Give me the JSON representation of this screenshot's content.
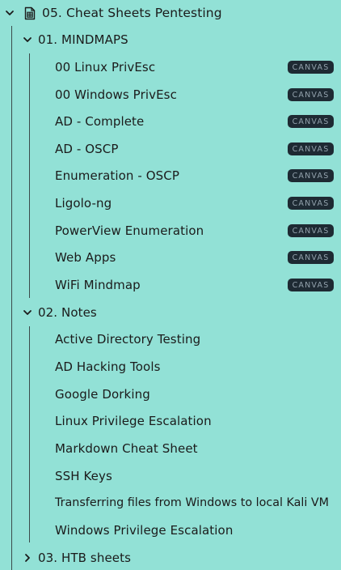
{
  "root": {
    "label": "05. Cheat Sheets Pentesting",
    "icon": "spreadsheet-file-icon",
    "expanded": true
  },
  "folders": [
    {
      "label": "01. MINDMAPS",
      "expanded": true,
      "items": [
        {
          "label": "00 Linux PrivEsc",
          "badge": "CANVAS"
        },
        {
          "label": "00 Windows PrivEsc",
          "badge": "CANVAS"
        },
        {
          "label": "AD - Complete",
          "badge": "CANVAS"
        },
        {
          "label": "AD - OSCP",
          "badge": "CANVAS"
        },
        {
          "label": "Enumeration - OSCP",
          "badge": "CANVAS"
        },
        {
          "label": "Ligolo-ng",
          "badge": "CANVAS"
        },
        {
          "label": "PowerView Enumeration",
          "badge": "CANVAS"
        },
        {
          "label": "Web Apps",
          "badge": "CANVAS"
        },
        {
          "label": "WiFi Mindmap",
          "badge": "CANVAS"
        }
      ]
    },
    {
      "label": "02. Notes",
      "expanded": true,
      "items": [
        {
          "label": "Active Directory Testing"
        },
        {
          "label": "AD Hacking Tools"
        },
        {
          "label": "Google Dorking"
        },
        {
          "label": "Linux Privilege Escalation"
        },
        {
          "label": "Markdown Cheat Sheet"
        },
        {
          "label": "SSH Keys"
        },
        {
          "label": "Transferring files from Windows to local Kali VM"
        },
        {
          "label": "Windows Privilege Escalation"
        }
      ]
    },
    {
      "label": "03. HTB sheets",
      "expanded": false,
      "items": []
    }
  ],
  "colors": {
    "background": "#92e1d6",
    "text": "#1b1b1b",
    "badge_bg": "#1e2a33",
    "badge_text": "#93a2ad",
    "guide_line": "#3b4a4a"
  }
}
